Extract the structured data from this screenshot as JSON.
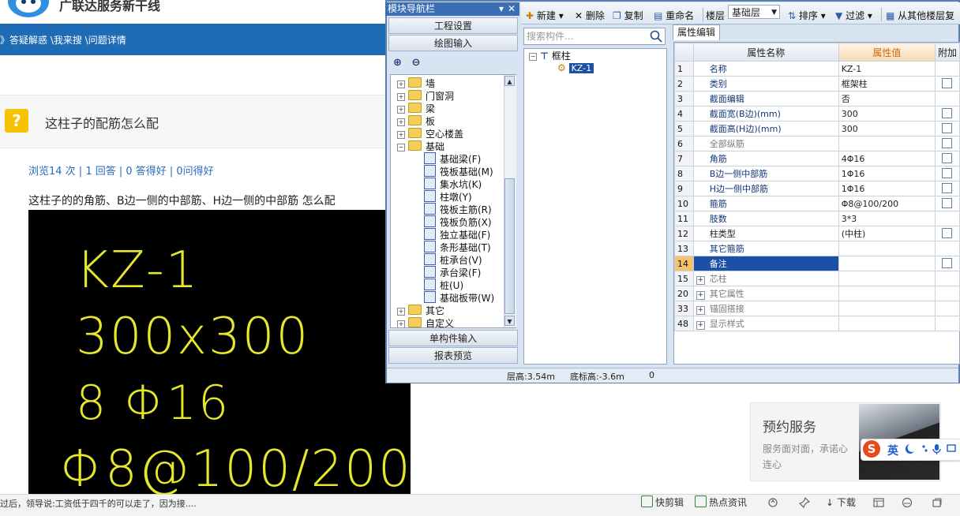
{
  "web": {
    "site_title": "广联达服务新干线",
    "breadcrumb": "》答疑解惑 \\我来搜 \\问题详情",
    "question_title": "这柱子的配筋怎么配",
    "stats": "浏览14 次 | 1 回答 | 0 答得好 | 0问得好",
    "body_text": "这柱子的的角筋、B边一侧的中部筋、H边一侧的中部筋   怎么配",
    "cad_lines": [
      "KZ-1",
      "300x300",
      "8 Φ16",
      "Φ8@100/200"
    ],
    "ad_title": "预约服务",
    "ad_text": "服务面对面，承诺心连心",
    "ticker": "过后，领导说:工资低于四千的可以走了，因为接....",
    "taskbar": [
      "快剪辑",
      "热点资讯",
      "下载"
    ],
    "ime_label": "英"
  },
  "app": {
    "nav_title": "模块导航栏",
    "nav_pin": "▾",
    "nav_close": "✕",
    "nav_buttons_top": [
      "工程设置",
      "绘图输入"
    ],
    "nav_buttons_bottom": [
      "单构件输入",
      "报表预览"
    ],
    "plus_minus": "+̈ −̈",
    "nav_tree": {
      "top": [
        "墙",
        "门窗洞",
        "梁",
        "板",
        "空心楼盖",
        "基础"
      ],
      "children": [
        "基础梁(F)",
        "筏板基础(M)",
        "集水坑(K)",
        "柱墩(Y)",
        "筏板主筋(R)",
        "筏板负筋(X)",
        "独立基础(F)",
        "条形基础(T)",
        "桩承台(V)",
        "承台梁(F)",
        "桩(U)",
        "基础板带(W)"
      ],
      "bottom": [
        "其它",
        "自定义"
      ]
    },
    "toolbar": {
      "new": "新建",
      "delete": "删除",
      "copy": "复制",
      "rename": "重命名",
      "floor": "楼层",
      "floor_value": "基础层",
      "sort": "排序",
      "filter": "过滤",
      "copy_from": "从其他楼层复"
    },
    "search_placeholder": "搜索构件...",
    "component_tree": {
      "root": "框柱",
      "child": "KZ-1"
    },
    "status": {
      "floor_height": "层高:3.54m",
      "bottom_elevation": "底标高:-3.6m",
      "value": "0"
    },
    "prop_tab": "属性编辑",
    "prop_headers": {
      "name": "属性名称",
      "value": "属性值",
      "extra": "附加"
    },
    "props": [
      {
        "n": "1",
        "name": "名称",
        "value": "KZ-1",
        "style": "blue",
        "chk": false
      },
      {
        "n": "2",
        "name": "类别",
        "value": "框架柱",
        "style": "blue",
        "chk": true
      },
      {
        "n": "3",
        "name": "截面编辑",
        "value": "否",
        "style": "blue",
        "chk": false
      },
      {
        "n": "4",
        "name": "截面宽(B边)(mm)",
        "value": "300",
        "style": "blue",
        "chk": true
      },
      {
        "n": "5",
        "name": "截面高(H边)(mm)",
        "value": "300",
        "style": "blue",
        "chk": true
      },
      {
        "n": "6",
        "name": "全部纵筋",
        "value": "",
        "style": "gray",
        "chk": true
      },
      {
        "n": "7",
        "name": "角筋",
        "value": "4Φ16",
        "style": "blue",
        "chk": true
      },
      {
        "n": "8",
        "name": "B边一侧中部筋",
        "value": "1Φ16",
        "style": "blue",
        "chk": true
      },
      {
        "n": "9",
        "name": "H边一侧中部筋",
        "value": "1Φ16",
        "style": "blue",
        "chk": true
      },
      {
        "n": "10",
        "name": "箍筋",
        "value": "Φ8@100/200",
        "style": "blue",
        "chk": true
      },
      {
        "n": "11",
        "name": "肢数",
        "value": "3*3",
        "style": "blue",
        "chk": false
      },
      {
        "n": "12",
        "name": "柱类型",
        "value": "(中柱)",
        "style": "plain",
        "chk": true
      },
      {
        "n": "13",
        "name": "其它箍筋",
        "value": "",
        "style": "blue",
        "chk": false
      },
      {
        "n": "14",
        "name": "备注",
        "value": "",
        "style": "sel",
        "chk": true
      }
    ],
    "prop_groups": [
      {
        "n": "15",
        "name": "芯柱"
      },
      {
        "n": "20",
        "name": "其它属性"
      },
      {
        "n": "33",
        "name": "锚固搭接"
      },
      {
        "n": "48",
        "name": "显示样式"
      }
    ]
  }
}
